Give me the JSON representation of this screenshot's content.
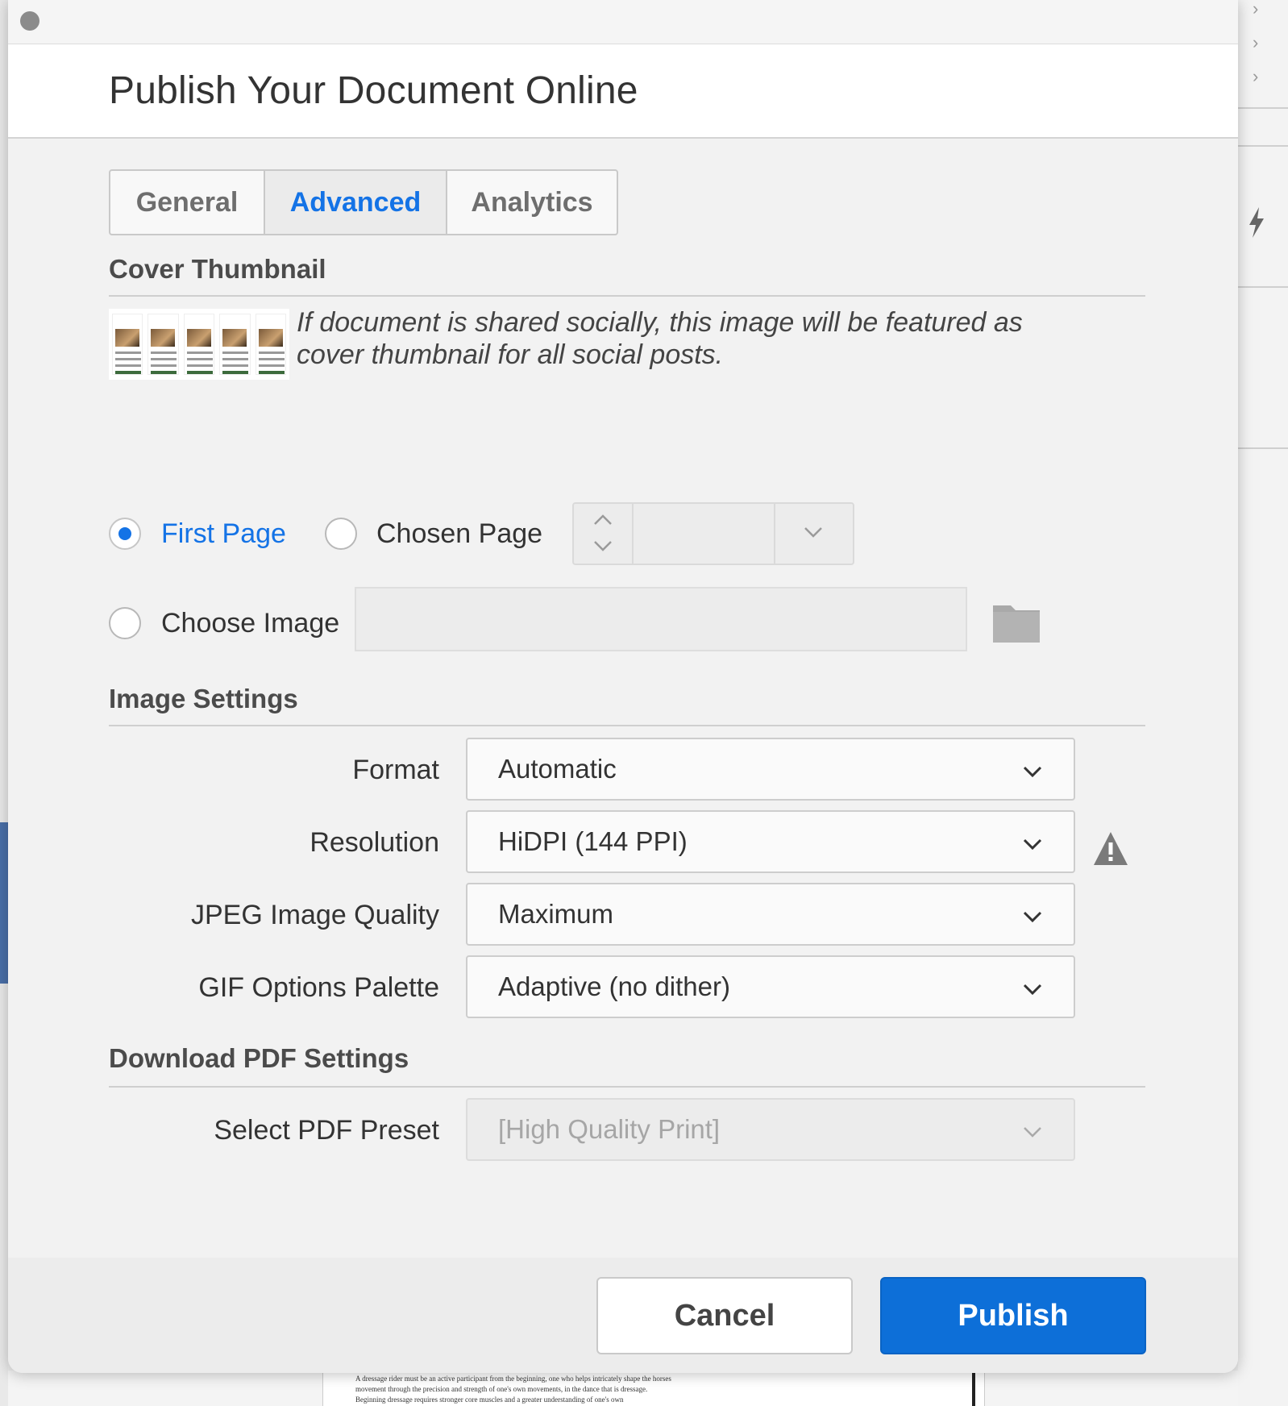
{
  "dialog": {
    "title": "Publish Your Document Online"
  },
  "tabs": [
    {
      "label": "General",
      "active": false
    },
    {
      "label": "Advanced",
      "active": true
    },
    {
      "label": "Analytics",
      "active": false
    }
  ],
  "cover_thumbnail": {
    "heading": "Cover Thumbnail",
    "caption": "If document is shared socially, this image will be featured as cover thumbnail for all social posts.",
    "options": {
      "first_page": "First Page",
      "chosen_page": "Chosen Page",
      "choose_image": "Choose Image"
    },
    "selected": "first_page",
    "chosen_page_value": "",
    "image_path": ""
  },
  "image_settings": {
    "heading": "Image Settings",
    "format_label": "Format",
    "format_value": "Automatic",
    "resolution_label": "Resolution",
    "resolution_value": "HiDPI (144 PPI)",
    "jpeg_label": "JPEG Image Quality",
    "jpeg_value": "Maximum",
    "gif_label": "GIF Options Palette",
    "gif_value": "Adaptive (no dither)"
  },
  "pdf_settings": {
    "heading": "Download PDF Settings",
    "preset_label": "Select PDF Preset",
    "preset_value": "[High Quality Print]"
  },
  "buttons": {
    "cancel": "Cancel",
    "publish": "Publish"
  },
  "background": {
    "bottom_text": "A dressage rider must be an active participant from the beginning, one who helps intricately shape the horses movement through the precision and strength of one's own movements, in the dance that is dressage. Beginning dressage requires stronger core muscles and a greater understanding of one's own"
  },
  "colors": {
    "accent": "#1473e6",
    "publish_button": "#0d6fd8"
  },
  "icons": [
    "close-icon",
    "chevron-up-icon",
    "chevron-down-icon",
    "folder-icon",
    "warning-icon",
    "bolt-icon",
    "chevron-right-icon"
  ]
}
